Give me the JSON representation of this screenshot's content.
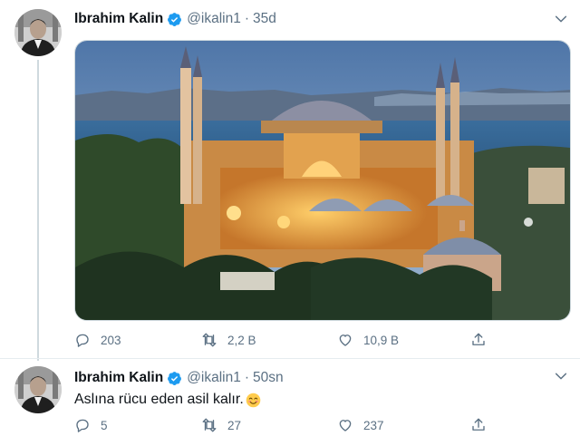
{
  "colors": {
    "accent": "#1d9bf0",
    "secondary_text": "#5b7083",
    "divider": "#e6ecf0"
  },
  "icons": {
    "verified": "verified-badge-icon",
    "caret": "chevron-down-icon",
    "reply": "reply-icon",
    "retweet": "retweet-icon",
    "like": "heart-icon",
    "share": "share-icon",
    "emoji": "smiling-face-emoji"
  },
  "tweets": [
    {
      "author": {
        "name": "Ibrahim Kalin",
        "handle": "@ikalin1"
      },
      "separator": "·",
      "time": "35d",
      "text": "",
      "stats": {
        "replies": "203",
        "retweets": "2,2 B",
        "likes": "10,9 B"
      }
    },
    {
      "author": {
        "name": "Ibrahim Kalin",
        "handle": "@ikalin1"
      },
      "separator": "·",
      "time": "50sn",
      "text": "Aslına rücu eden asil kalır.",
      "stats": {
        "replies": "5",
        "retweets": "27",
        "likes": "237"
      }
    }
  ]
}
